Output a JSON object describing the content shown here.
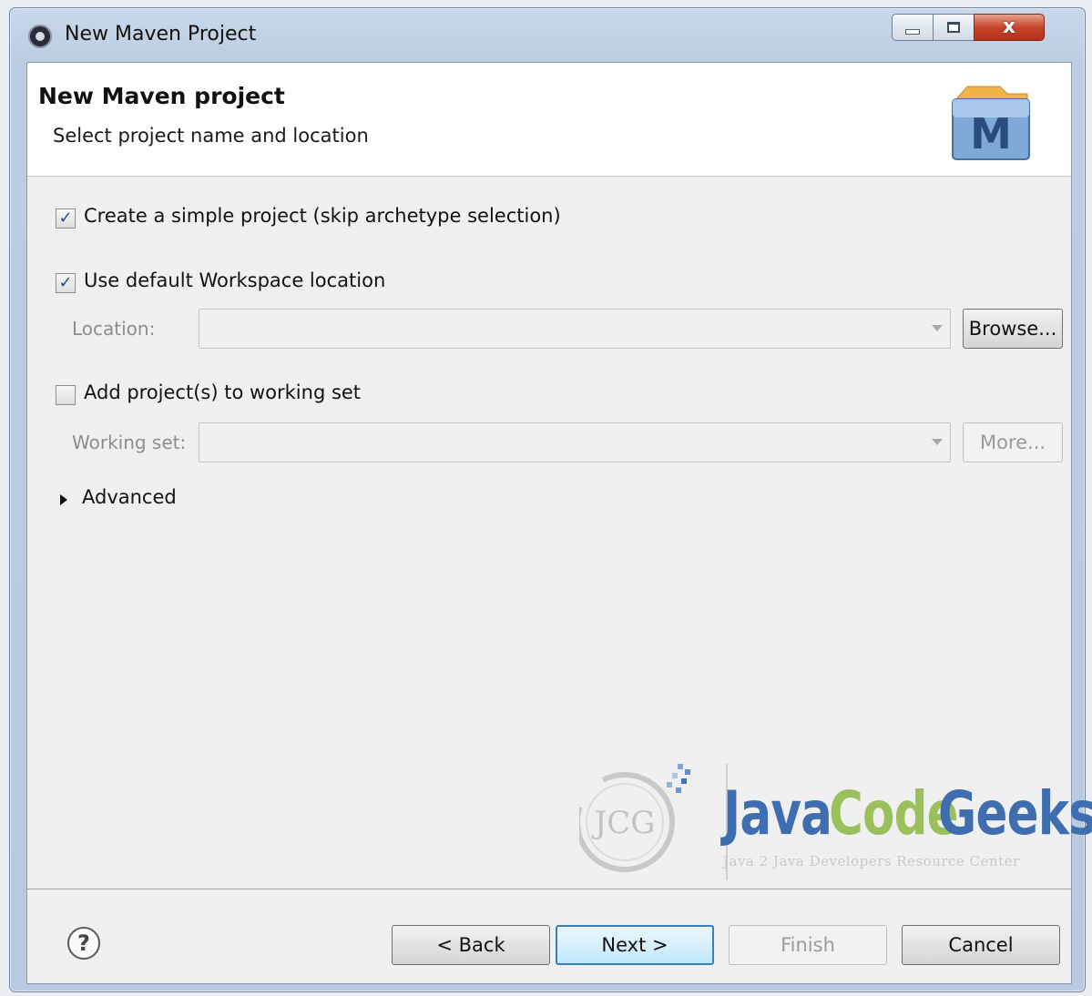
{
  "window": {
    "title": "New Maven Project",
    "close_glyph": "x"
  },
  "banner": {
    "title": "New Maven project",
    "subtitle": "Select project name and location",
    "logo_letter": "M"
  },
  "options": {
    "simple_project": {
      "label": "Create a simple project (skip archetype selection)",
      "checked": true
    },
    "default_workspace": {
      "label": "Use default Workspace location",
      "checked": true
    },
    "location": {
      "label": "Location:",
      "value": "",
      "browse_label": "Browse..."
    },
    "working_set_add": {
      "label": "Add project(s) to working set",
      "checked": false
    },
    "working_set": {
      "label": "Working set:",
      "value": "",
      "more_label": "More..."
    },
    "advanced": {
      "label": "Advanced",
      "expanded": false
    }
  },
  "footer": {
    "help_glyph": "?",
    "back_label": "< Back",
    "next_label": "Next >",
    "finish_label": "Finish",
    "cancel_label": "Cancel"
  },
  "watermark": {
    "monogram": "JCG",
    "brand_java": "Java",
    "brand_code": "Code",
    "brand_geeks": "Geeks",
    "tagline": "Java 2 Java Developers Resource Center"
  },
  "colors": {
    "checkmark": "#254a8a",
    "default_button_border": "#3c7fb1",
    "jcg_blue": "#3e6db0",
    "jcg_green": "#9bbf5a"
  },
  "icons": {
    "app": "eclipse-icon",
    "help": "help-icon",
    "maven": "maven-logo-icon"
  }
}
